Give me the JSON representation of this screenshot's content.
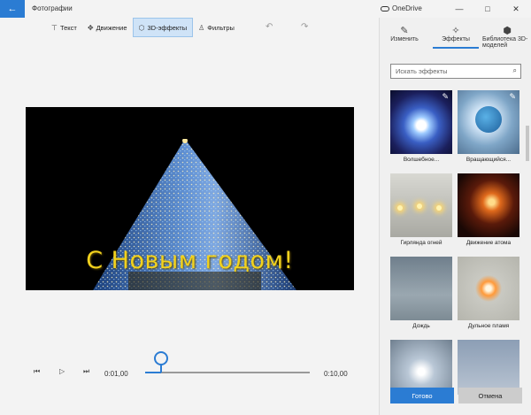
{
  "app": {
    "title": "Фотографии",
    "back_icon": "back-arrow-icon"
  },
  "titlebar": {
    "onedrive": "OneDrive",
    "minimize": "—",
    "maximize": "□",
    "close": "✕"
  },
  "toolbar": {
    "items": [
      {
        "label": "Текст",
        "icon": "text-icon"
      },
      {
        "label": "Движение",
        "icon": "motion-icon"
      },
      {
        "label": "3D-эффекты",
        "icon": "3d-effects-icon",
        "active": true
      },
      {
        "label": "Фильтры",
        "icon": "filters-icon"
      }
    ],
    "undo": "↶",
    "redo": "↷"
  },
  "preview": {
    "caption": "С Новым годом!"
  },
  "playback": {
    "current_time": "0:01,00",
    "total_time": "0:10,00",
    "progress": 0.1
  },
  "panel": {
    "tabs": [
      {
        "label": "Изменить",
        "icon": "edit-icon"
      },
      {
        "label": "Эффекты",
        "icon": "effects-icon",
        "active": true
      },
      {
        "label": "Библиотека 3D-моделей",
        "icon": "3d-library-icon"
      }
    ],
    "search_placeholder": "Искать эффекты",
    "effects": [
      {
        "label": "Волшебное...",
        "featured": true
      },
      {
        "label": "Вращающийся...",
        "featured": true
      },
      {
        "label": "Гирлянда огней"
      },
      {
        "label": "Движение атома"
      },
      {
        "label": "Дождь"
      },
      {
        "label": "Дульное пламя"
      },
      {
        "label": ""
      },
      {
        "label": ""
      }
    ],
    "ok_label": "Готово",
    "cancel_label": "Отмена"
  },
  "colors": {
    "accent": "#2b7cd3",
    "caption": "#f2d21e"
  }
}
